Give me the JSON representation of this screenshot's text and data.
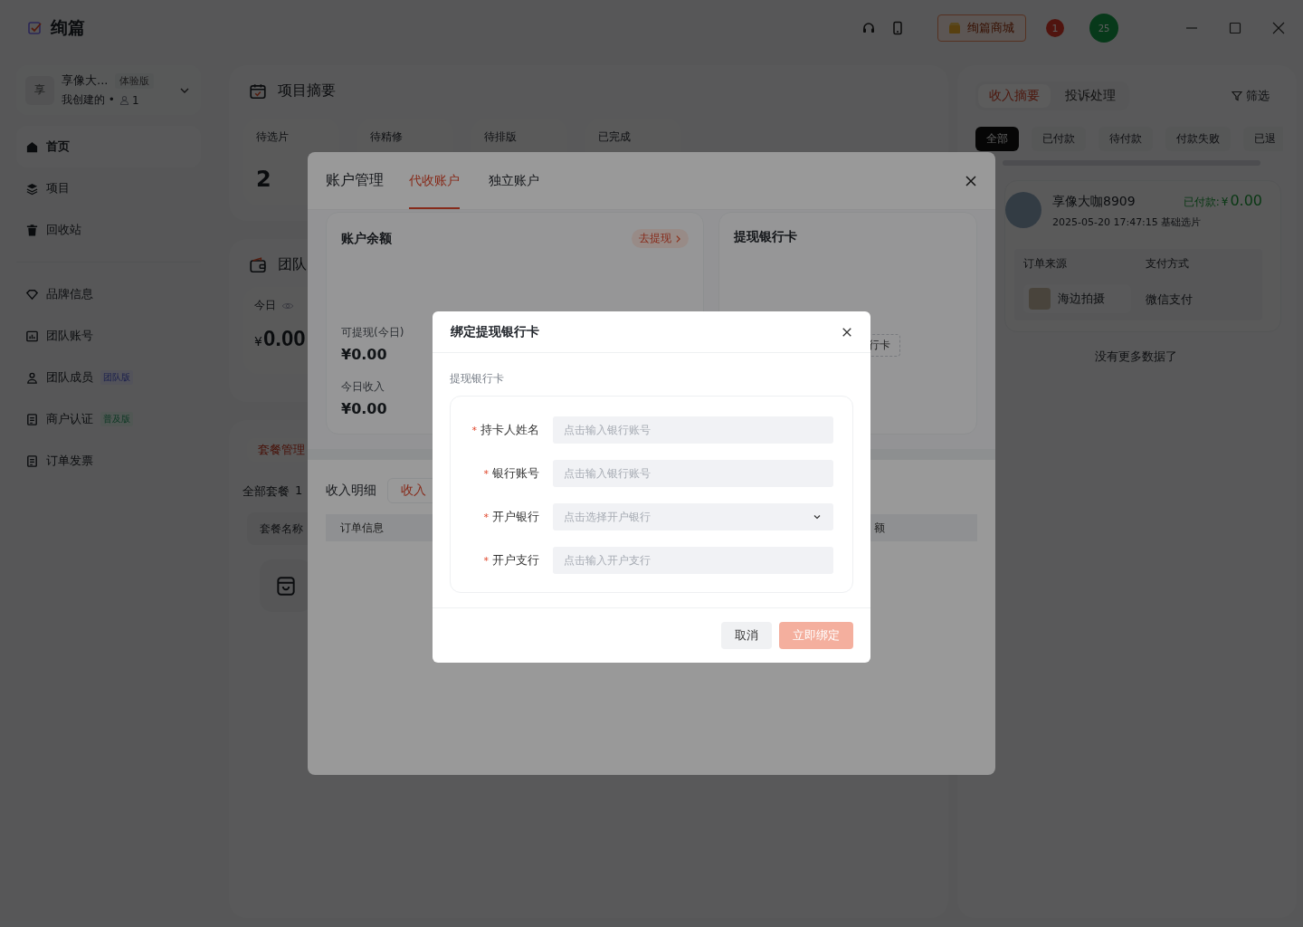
{
  "app": {
    "title": "绚篇",
    "store_button": "绚篇商城",
    "notification_badge": "1",
    "user_avatar": "25"
  },
  "workspace": {
    "avatar": "享",
    "name": "享像大...",
    "plan_badge": "体验版",
    "subtitle": "我创建的 •",
    "member_count": "1"
  },
  "nav_primary": [
    {
      "label": "首页",
      "selected": true
    },
    {
      "label": "项目",
      "selected": false
    },
    {
      "label": "回收站",
      "selected": false
    }
  ],
  "nav_secondary": [
    {
      "label": "品牌信息",
      "selected": false
    },
    {
      "label": "团队账号",
      "selected": false
    },
    {
      "label": "团队成员",
      "selected": false,
      "badge": {
        "text": "团队版",
        "kind": "team"
      }
    },
    {
      "label": "商户认证",
      "selected": false,
      "badge": {
        "text": "普及版",
        "kind": "basic"
      }
    },
    {
      "label": "订单发票",
      "selected": false
    }
  ],
  "project_summary": {
    "title": "项目摘要",
    "stats": [
      {
        "label": "待选片",
        "value": "2"
      },
      {
        "label": "待精修"
      },
      {
        "label": "待排版"
      },
      {
        "label": "已完成"
      }
    ]
  },
  "team_income": {
    "title": "团队",
    "stats": [
      {
        "label": "今日",
        "currency": "¥",
        "value": "0.00"
      }
    ]
  },
  "packages": {
    "tab": "套餐管理",
    "count_label": "全部套餐",
    "count": "1",
    "column": "套餐名称"
  },
  "income_panel": {
    "tabs": [
      {
        "label": "收入摘要",
        "selected": true
      },
      {
        "label": "投诉处理",
        "selected": false
      }
    ],
    "filter": "筛选",
    "chips": [
      {
        "label": "全部",
        "selected": true
      },
      {
        "label": "已付款",
        "selected": false
      },
      {
        "label": "待付款",
        "selected": false
      },
      {
        "label": "付款失败",
        "selected": false
      },
      {
        "label": "已退",
        "selected": false
      }
    ],
    "orders": [
      {
        "customer": "享像大咖8909",
        "status": "已付款:",
        "kind": "paid",
        "currency": "¥",
        "amount": "0.00",
        "meta": "2025-05-20 17:47:15 基础选片",
        "source_label": "订单来源",
        "source": "海边拍摄",
        "payment_label": "支付方式",
        "payment": "微信支付"
      }
    ],
    "end_note": "没有更多数据了"
  },
  "account_modal": {
    "title": "账户管理",
    "tabs": [
      {
        "label": "代收账户",
        "selected": true
      },
      {
        "label": "独立账户",
        "selected": false
      }
    ],
    "balance_card": {
      "title": "账户余额",
      "action": "去提现",
      "rows": [
        {
          "label": "可提现(今日)",
          "value": "¥0.00"
        },
        {
          "label": "今日收入",
          "value": "¥0.00"
        }
      ]
    },
    "bank_card": {
      "title": "提现银行卡",
      "button": "行卡"
    },
    "details": {
      "title": "收入明细",
      "tab": "收入",
      "columns": [
        "订单信息",
        "额"
      ]
    }
  },
  "bind_dialog": {
    "title": "绑定提现银行卡",
    "section": "提现银行卡",
    "fields": [
      {
        "label": "持卡人姓名",
        "required_mark": "*",
        "kind": "input",
        "placeholder": "点击输入银行账号"
      },
      {
        "label": "银行账号",
        "required_mark": "*",
        "kind": "input",
        "placeholder": "点击输入银行账号"
      },
      {
        "label": "开户银行",
        "required_mark": "*",
        "kind": "select",
        "placeholder": "点击选择开户银行"
      },
      {
        "label": "开户支行",
        "required_mark": "*",
        "kind": "input",
        "placeholder": "点击输入开户支行"
      }
    ],
    "buttons": [
      {
        "label": "取消",
        "kind": "secondary",
        "disabled": false
      },
      {
        "label": "立即绑定",
        "kind": "primary",
        "disabled": true
      }
    ]
  }
}
